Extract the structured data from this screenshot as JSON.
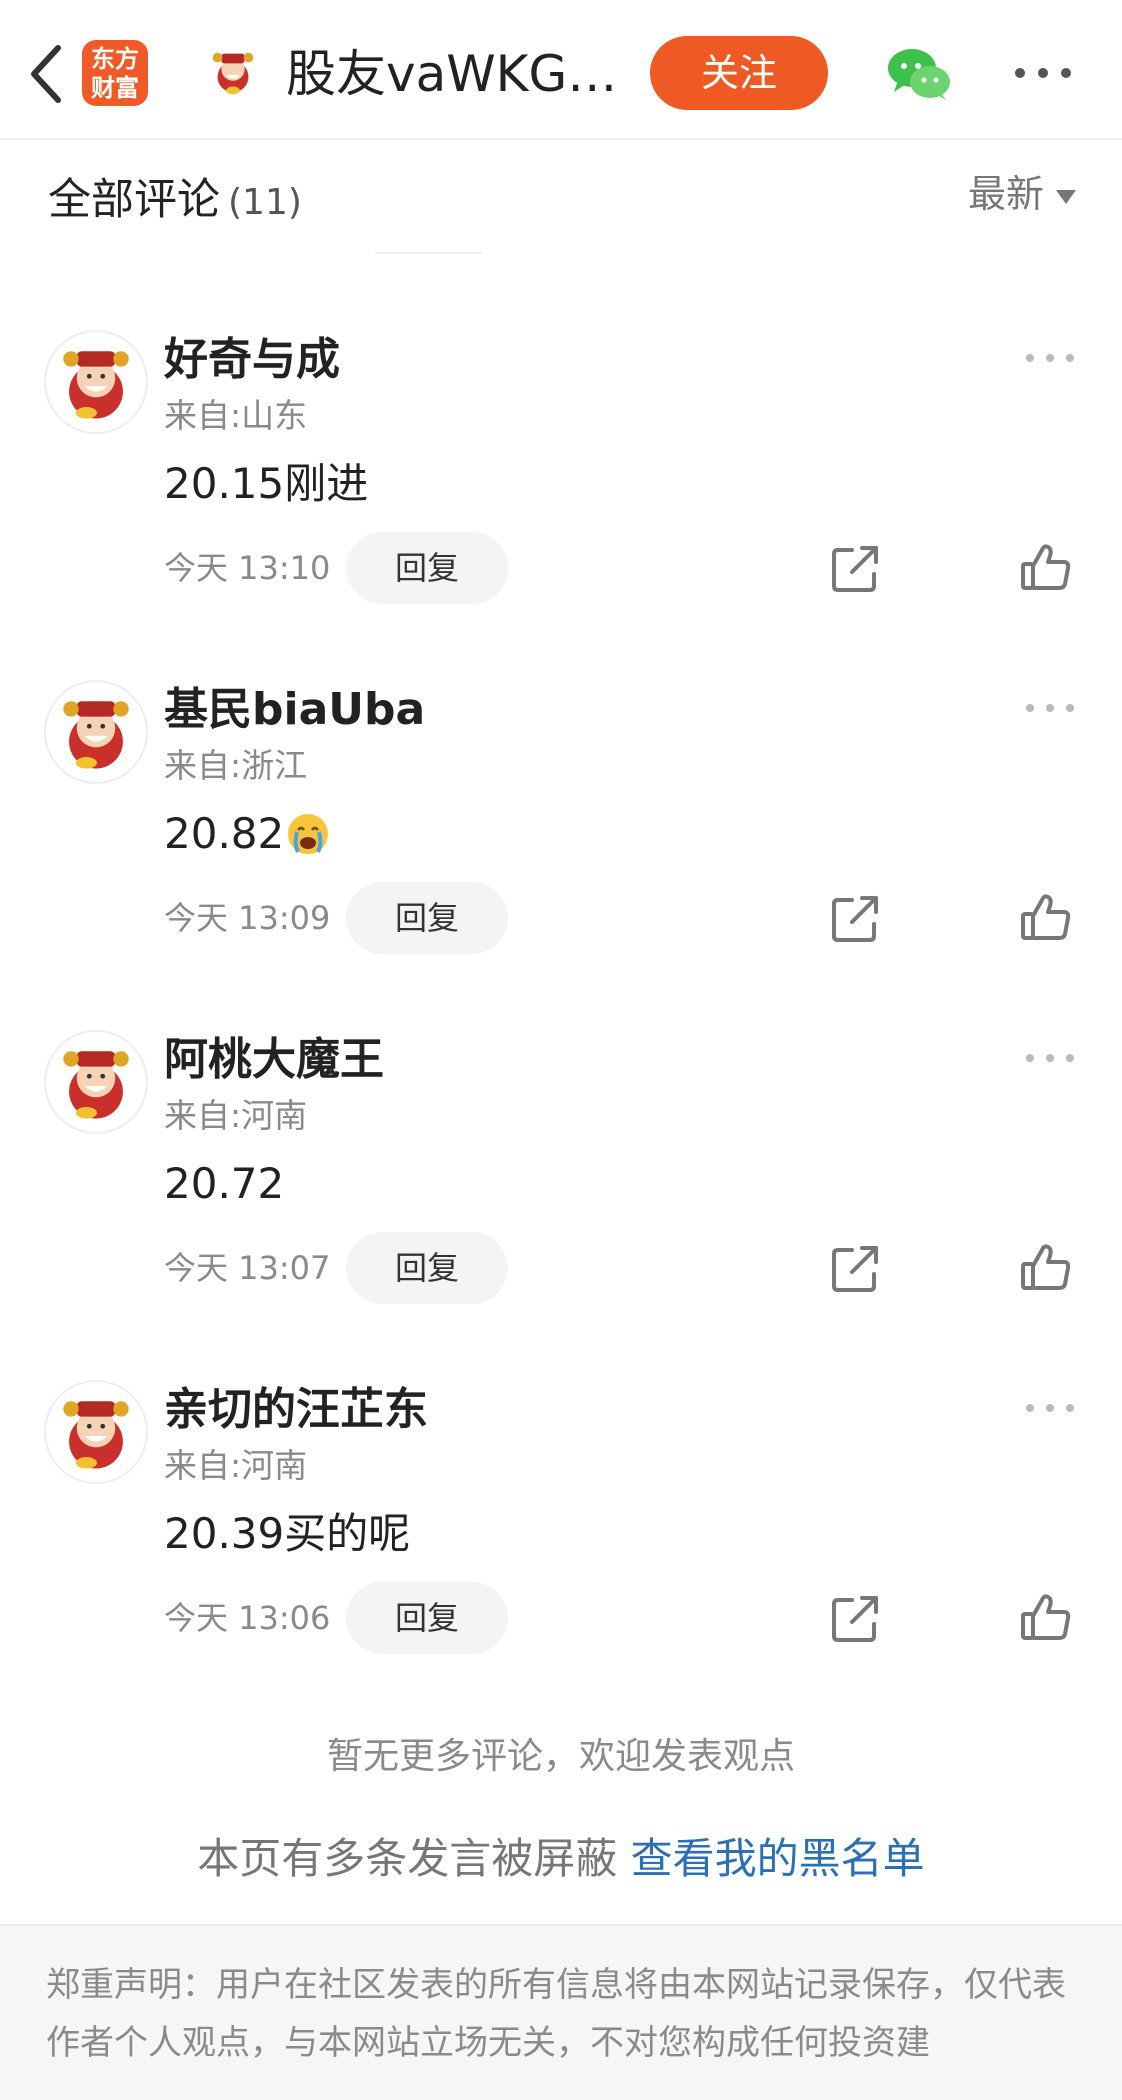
{
  "header": {
    "logo_text": "东方财富",
    "title": "股友vaWKGp...",
    "follow_label": "关注",
    "icons": [
      "back-arrow-icon",
      "app-logo-icon",
      "avatar",
      "wechat-icon",
      "more-icon"
    ]
  },
  "section": {
    "title": "全部评论",
    "count": "(11)",
    "sort_label": "最新"
  },
  "comments": [
    {
      "name": "好奇与成",
      "from": "来自:山东",
      "text": "20.15刚进",
      "time": "今天 13:10",
      "reply_label": "回复",
      "emoji": ""
    },
    {
      "name": "基民biaUba",
      "from": "来自:浙江",
      "text": "20.82",
      "time": "今天 13:09",
      "reply_label": "回复",
      "emoji": "crying-emoji"
    },
    {
      "name": "阿桃大魔王",
      "from": "来自:河南",
      "text": "20.72",
      "time": "今天 13:07",
      "reply_label": "回复",
      "emoji": ""
    },
    {
      "name": "亲切的汪芷东",
      "from": "来自:河南",
      "text": "20.39买的呢",
      "time": "今天 13:06",
      "reply_label": "回复",
      "emoji": ""
    }
  ],
  "footer": {
    "no_more": "暂无更多评论，欢迎发表观点",
    "blocked_text": "本页有多条发言被屏蔽",
    "blocked_link": "查看我的黑名单",
    "disclaimer": "郑重声明：用户在社区发表的所有信息将由本网站记录保存，仅代表作者个人观点，与本网站立场无关，不对您构成任何投资建"
  },
  "colors": {
    "accent": "#ef5a24",
    "link": "#2d6fb4",
    "muted": "#8a8a8a"
  }
}
